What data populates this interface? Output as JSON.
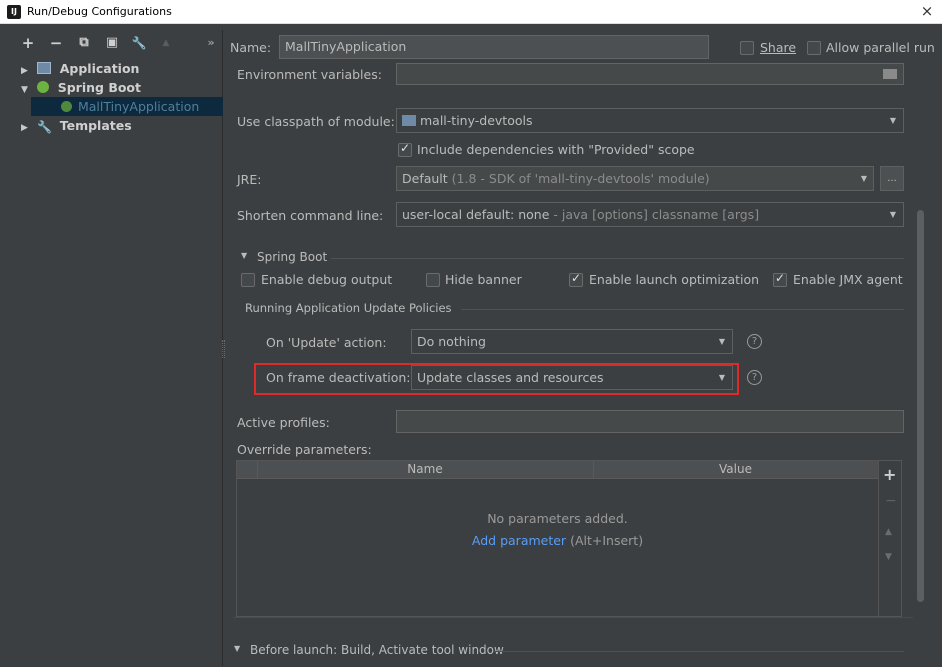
{
  "window": {
    "title": "Run/Debug Configurations",
    "close_glyph": "×",
    "app_icon_text": "IJ"
  },
  "toolbar": {
    "add": "+",
    "remove": "−",
    "copy": "⧉",
    "save": "▣",
    "wrench": "🔧",
    "up": "▲",
    "more": "»"
  },
  "tree": [
    {
      "label": "Application",
      "expanded": false,
      "icon": "application-icon"
    },
    {
      "label": "Spring Boot",
      "expanded": true,
      "icon": "spring-boot-icon"
    },
    {
      "label": "MallTinyApplication",
      "selected": true,
      "icon": "spring-app-icon"
    },
    {
      "label": "Templates",
      "expanded": false,
      "icon": "wrench-icon"
    }
  ],
  "header": {
    "name_label": "Name:",
    "name_value": "MallTinyApplication",
    "share_label": "Share",
    "parallel_label": "Allow parallel run"
  },
  "form": {
    "env_label": "Environment variables:",
    "classpath_label": "Use classpath of module:",
    "classpath_value": "mall-tiny-devtools",
    "include_deps_label": "Include dependencies with \"Provided\" scope",
    "jre_label": "JRE:",
    "jre_value": "Default",
    "jre_hint": "(1.8 - SDK of 'mall-tiny-devtools' module)",
    "jre_browse": "...",
    "shorten_label": "Shorten command line:",
    "shorten_value": "user-local default: none",
    "shorten_hint": "- java [options] classname [args]"
  },
  "spring_boot": {
    "section_label": "Spring Boot",
    "debug_output": "Enable debug output",
    "hide_banner": "Hide banner",
    "launch_opt": "Enable launch optimization",
    "jmx_agent": "Enable JMX agent",
    "policies_label": "Running Application Update Policies",
    "on_update_label": "On 'Update' action:",
    "on_update_value": "Do nothing",
    "on_frame_label": "On frame deactivation:",
    "on_frame_value": "Update classes and resources",
    "help_glyph": "?"
  },
  "profiles": {
    "active_label": "Active profiles:",
    "override_label": "Override parameters:"
  },
  "table": {
    "columns": [
      "Name",
      "Value"
    ],
    "empty_text": "No parameters added.",
    "add_link": "Add parameter",
    "add_hint": "(Alt+Insert)",
    "side_buttons": [
      "+",
      "−",
      "▲",
      "▼"
    ]
  },
  "footer": {
    "before_launch": "Before launch: Build, Activate tool window"
  },
  "colors": {
    "background": "#3c3f41",
    "highlight_box": "#e02a2a",
    "link": "#589df6",
    "selection": "#0d293e"
  }
}
